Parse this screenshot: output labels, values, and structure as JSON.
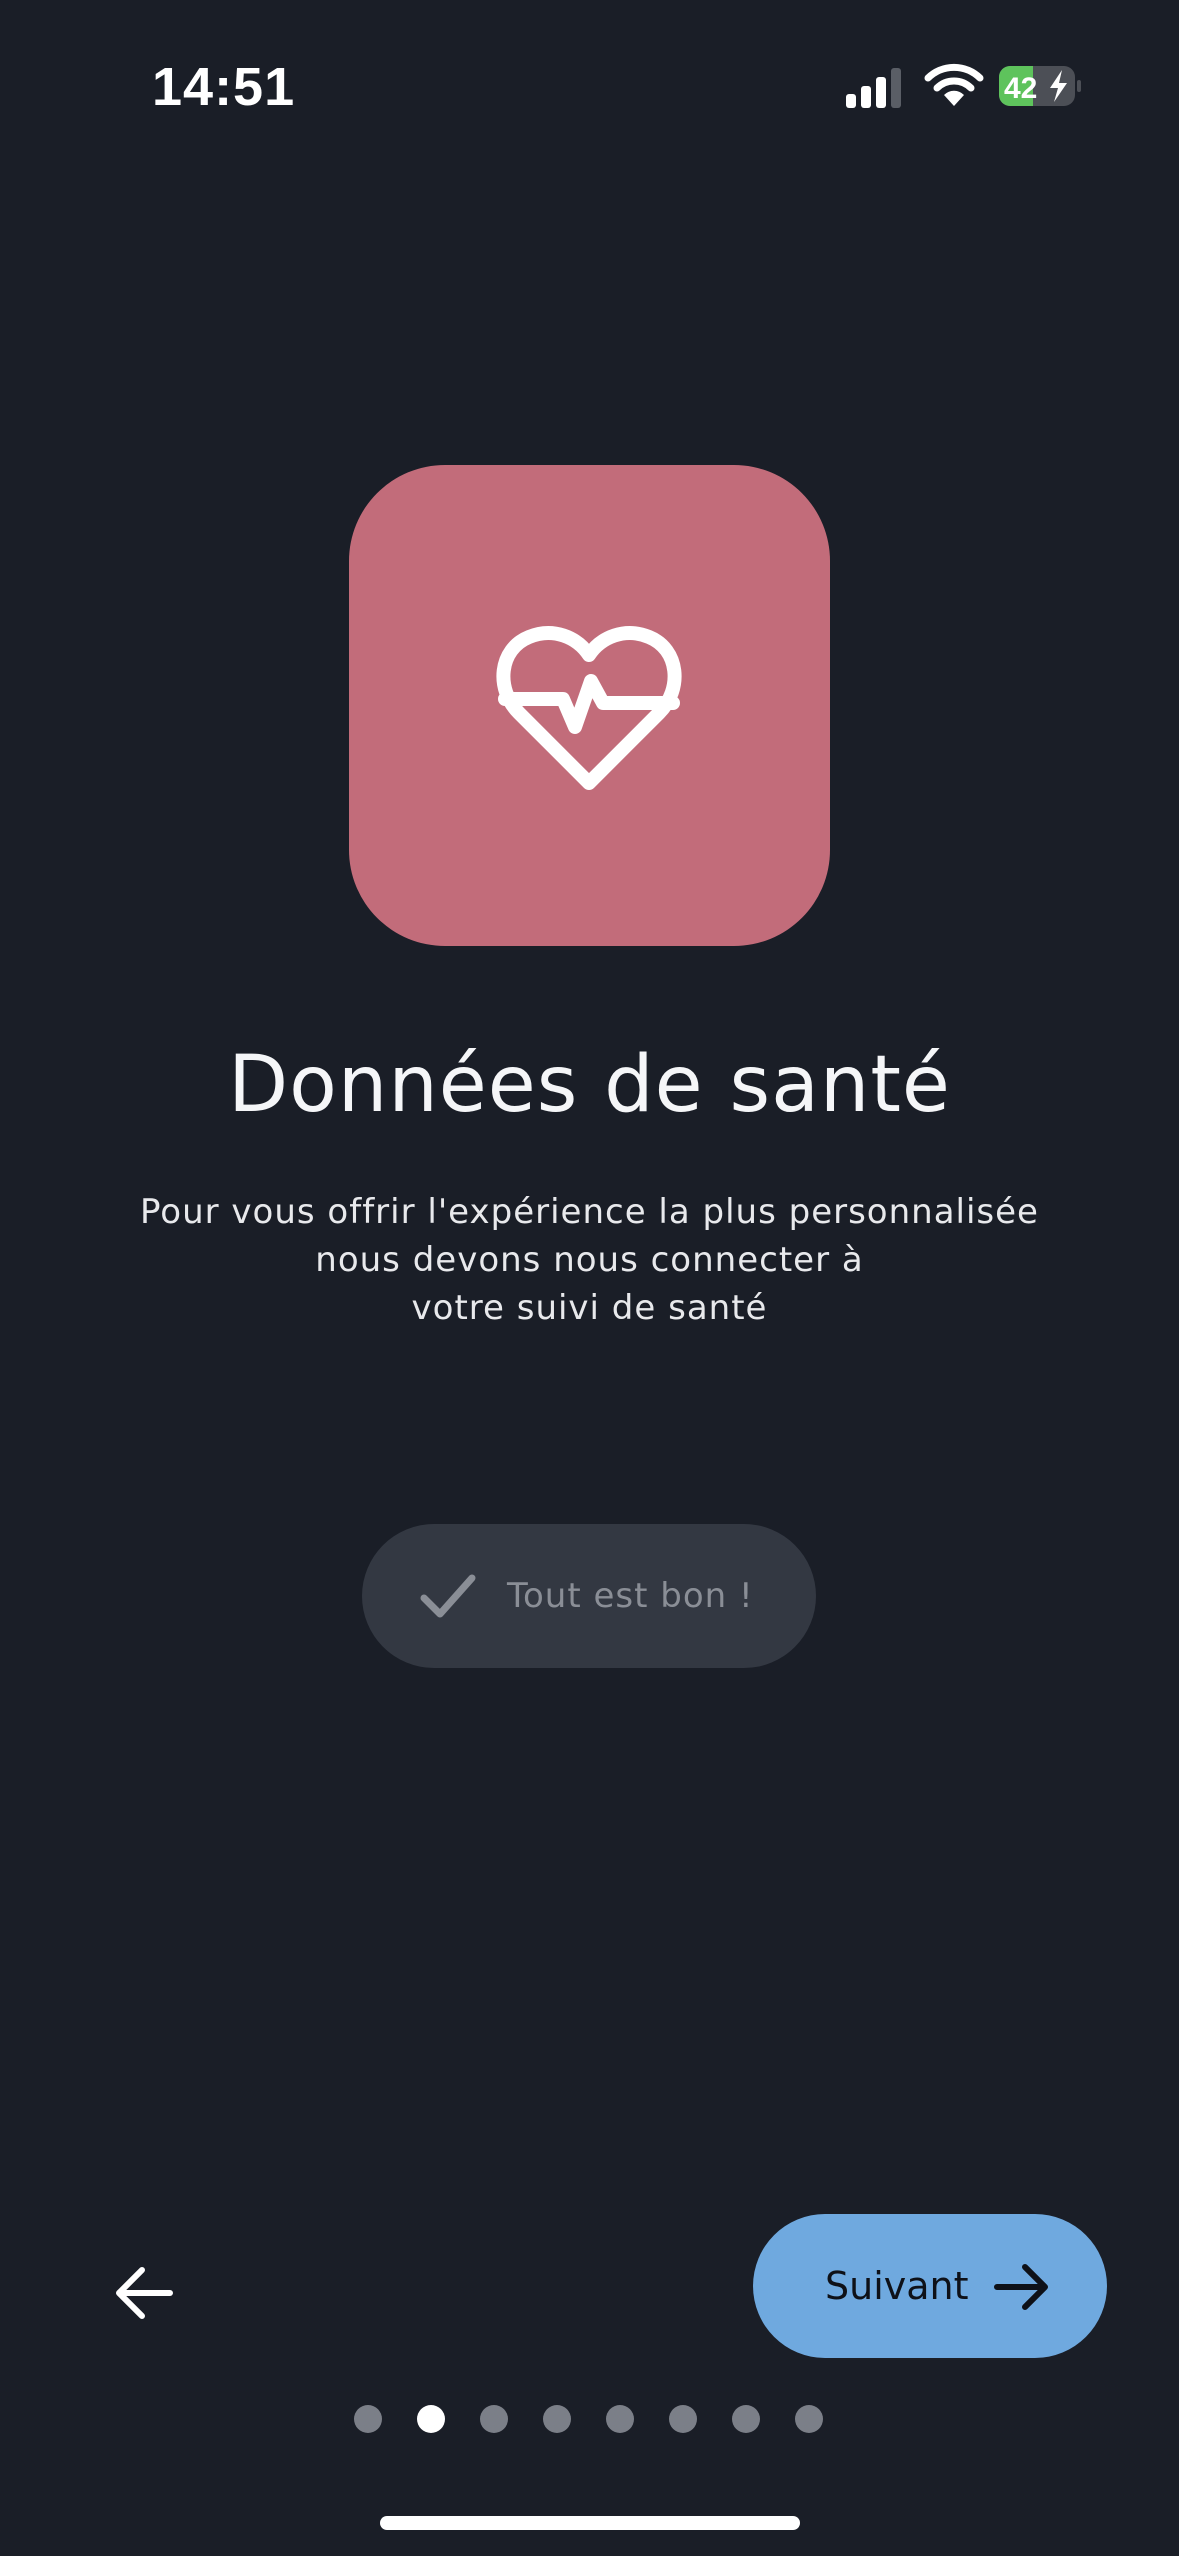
{
  "status_bar": {
    "time": "14:51",
    "battery_level": "42",
    "signal_icon": "cellular-signal-icon",
    "wifi_icon": "wifi-icon",
    "battery_icon": "battery-charging-icon"
  },
  "hero": {
    "icon": "heart-pulse-icon",
    "tile_color": "#c26c7a"
  },
  "title": "Données de santé",
  "subtitle": {
    "line1": "Pour vous offrir l'expérience la plus personnalisée",
    "line2": "nous devons nous connecter à",
    "line3": "votre suivi de santé"
  },
  "status_pill": {
    "label": "Tout est bon !",
    "icon": "checkmark-icon"
  },
  "navigation": {
    "back_icon": "arrow-left-icon",
    "next_label": "Suivant",
    "next_icon": "arrow-right-icon",
    "accent_color": "#6fa9df"
  },
  "pager": {
    "count": 8,
    "active_index": 1
  }
}
